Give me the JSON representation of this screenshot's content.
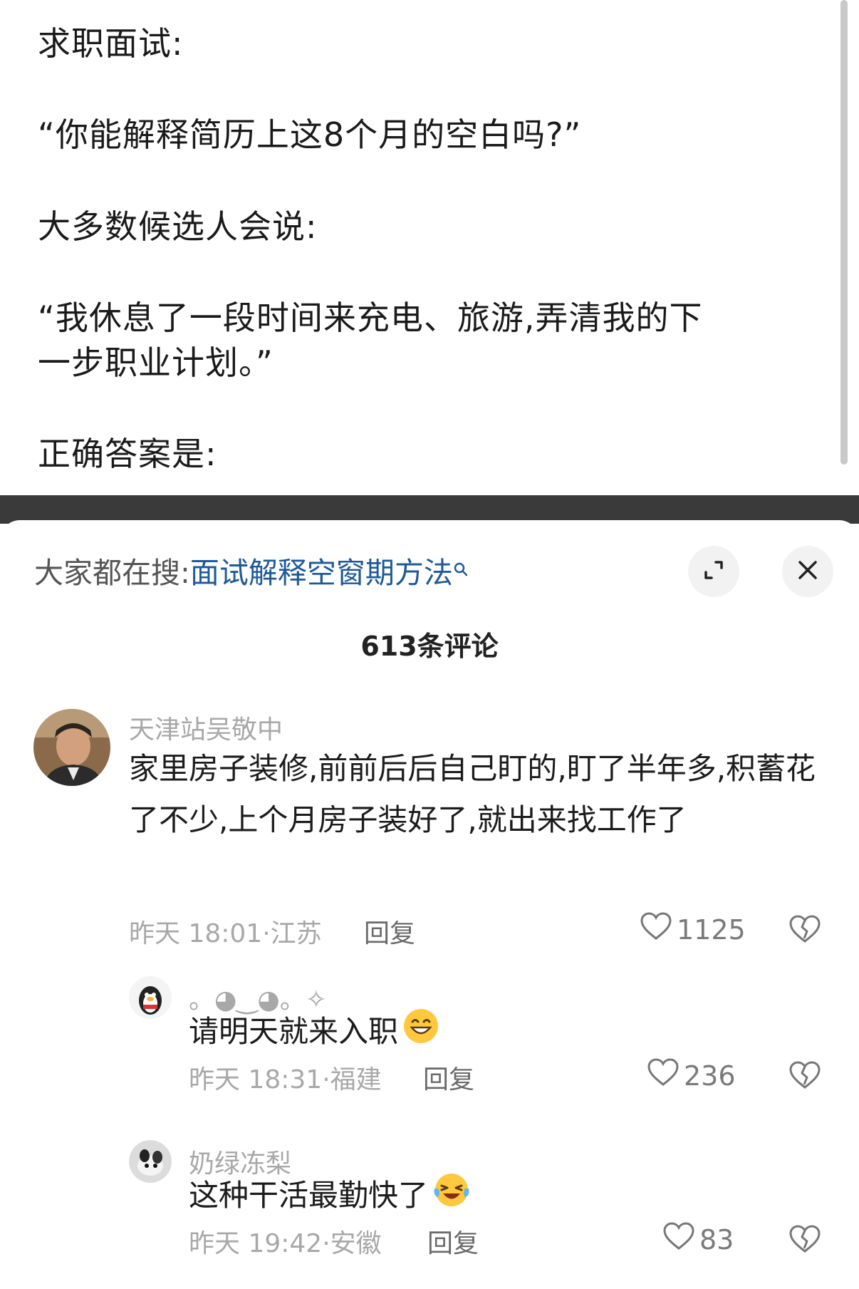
{
  "post": {
    "lines": [
      "求职面试:",
      "“你能解释简历上这8个月的空白吗?”",
      "大多数候选人会说:",
      "“我休息了一段时间来充电、旅游,弄清我的下",
      "一步职业计划。”",
      "正确答案是:"
    ]
  },
  "sheet": {
    "search_prefix": "大家都在搜:",
    "search_query": "面试解释空窗期方法",
    "comment_count": "613条评论",
    "icons": {
      "expand": "expand-icon",
      "close": "close-icon",
      "like": "heart-outline-icon",
      "dislike": "broken-heart-icon"
    }
  },
  "comments": [
    {
      "username": "天津站吴敬中",
      "text": "家里房子装修,前前后后自己盯的,盯了半年多,积蓄花了不少,上个月房子装好了,就出来找工作了",
      "time_location": "昨天 18:01·江苏",
      "reply_label": "回复",
      "likes": "1125"
    },
    {
      "username": "。◕‿◕。✧",
      "text": "请明天就来入职",
      "emoji": "grinning-face-emoji",
      "time_location": "昨天 18:31·福建",
      "reply_label": "回复",
      "likes": "236"
    },
    {
      "username": "奶绿冻梨",
      "text": "这种干活最勤快了",
      "emoji": "laughing-crying-face-emoji",
      "time_location": "昨天 19:42·安徽",
      "reply_label": "回复",
      "likes": "83"
    }
  ]
}
